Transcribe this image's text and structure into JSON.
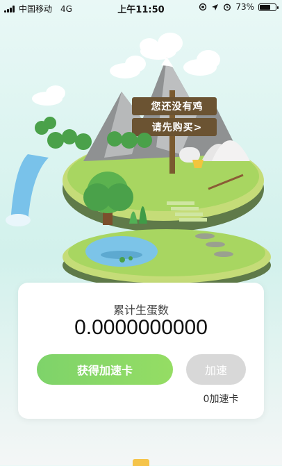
{
  "status_bar": {
    "carrier": "中国移动",
    "network": "4G",
    "time": "上午11:50",
    "battery": "73%",
    "battery_level": 0.73
  },
  "sign": {
    "line1": "您还没有鸡",
    "line2": "请先购买>"
  },
  "stats_card": {
    "title": "累计生蛋数",
    "value": "0.0000000000",
    "primary_button": "获得加速卡",
    "secondary_button": "加速",
    "card_count": "0加速卡"
  },
  "colors": {
    "accent_green": "#7ed36a",
    "disabled_gray": "#d8d8d8"
  }
}
